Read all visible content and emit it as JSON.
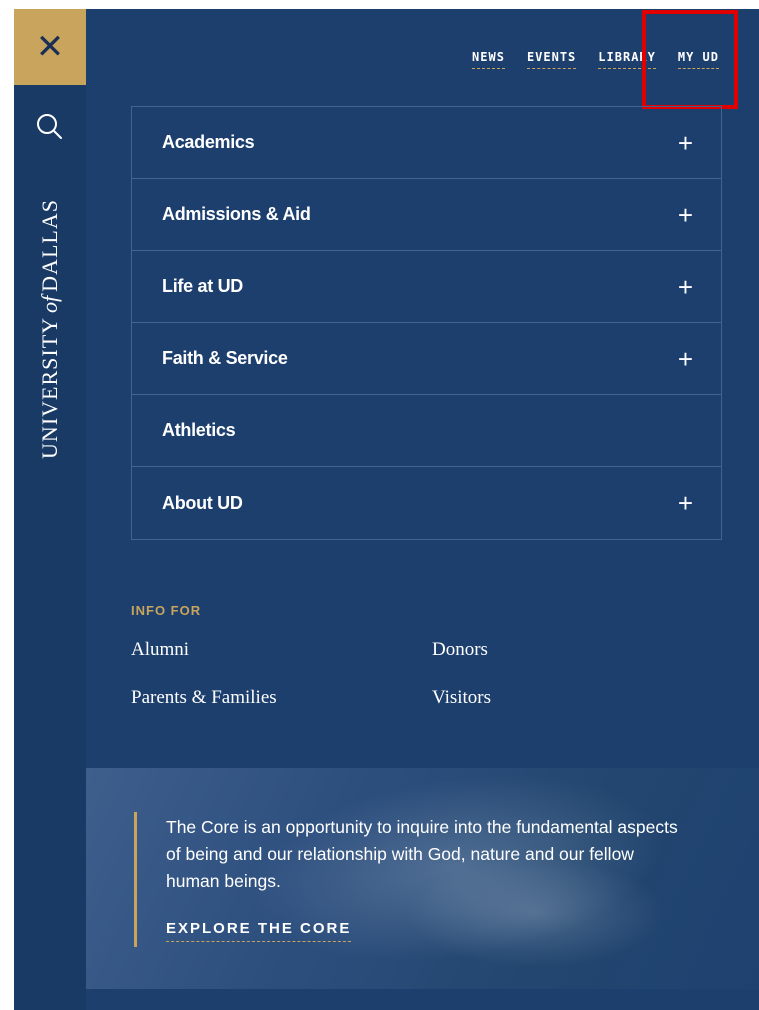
{
  "rail": {
    "close_icon": "close-icon",
    "search_icon": "search-icon",
    "logo_part1": "UNIVERSITY",
    "logo_part2": "of",
    "logo_part3": "DALLAS"
  },
  "top_nav": [
    {
      "label": "NEWS"
    },
    {
      "label": "EVENTS"
    },
    {
      "label": "LIBRARY"
    },
    {
      "label": "MY UD"
    }
  ],
  "menu": [
    {
      "label": "Academics",
      "expandable": true,
      "icon": "plus-icon"
    },
    {
      "label": "Admissions & Aid",
      "expandable": true,
      "icon": "plus-icon"
    },
    {
      "label": "Life at UD",
      "expandable": true,
      "icon": "plus-icon"
    },
    {
      "label": "Faith & Service",
      "expandable": true,
      "icon": "plus-icon"
    },
    {
      "label": "Athletics",
      "expandable": false
    },
    {
      "label": "About UD",
      "expandable": true,
      "icon": "plus-icon"
    }
  ],
  "info_for": {
    "heading": "INFO FOR",
    "links": [
      {
        "label": "Alumni"
      },
      {
        "label": "Donors"
      },
      {
        "label": "Parents & Families"
      },
      {
        "label": "Visitors"
      }
    ]
  },
  "promo": {
    "text": "The Core is an opportunity to inquire into the fundamental aspects of being and our relationship with God, nature and our fellow human beings.",
    "link_label": "EXPLORE THE CORE"
  },
  "colors": {
    "background": "#1d3f6e",
    "rail": "#1a3a66",
    "accent_gold": "#c9a45c",
    "highlight_red": "#e10000"
  }
}
